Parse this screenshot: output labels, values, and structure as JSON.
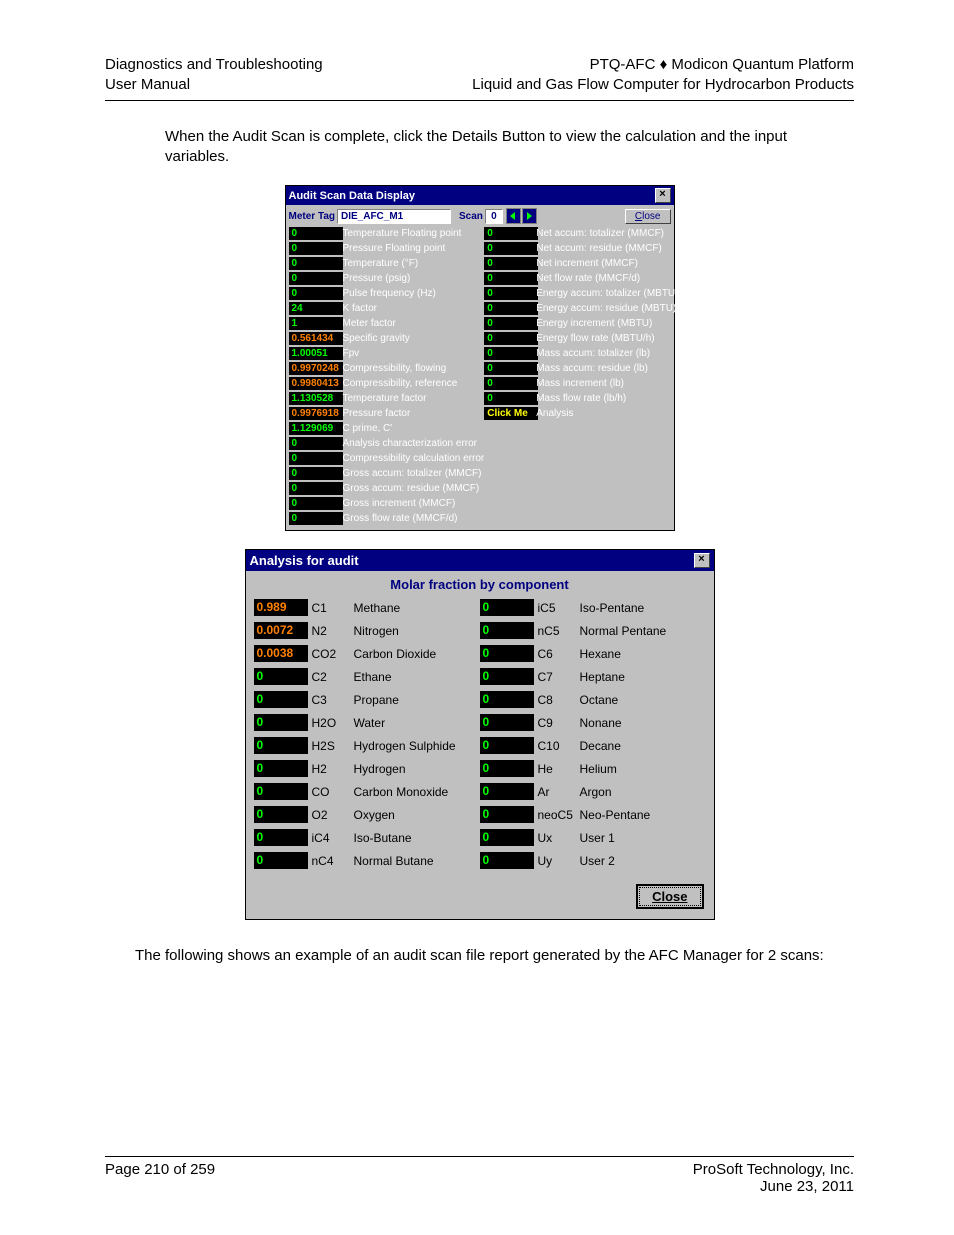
{
  "header": {
    "left1": "Diagnostics and Troubleshooting",
    "left2": "User Manual",
    "right1": "PTQ-AFC ♦ Modicon Quantum Platform",
    "right2": "Liquid and Gas Flow Computer for Hydrocarbon Products"
  },
  "paragraph1": "When the Audit Scan is complete, click the Details Button to view the calculation and the input variables.",
  "paragraph2": "The following shows an example of an audit scan file report generated by the AFC Manager for 2 scans:",
  "footer": {
    "page": "Page 210 of 259",
    "company": "ProSoft Technology, Inc.",
    "date": "June 23, 2011"
  },
  "audit": {
    "title": "Audit Scan Data Display",
    "meterTagLabel": "Meter Tag",
    "meterTagValue": "DIE_AFC_M1",
    "scanLabel": "Scan",
    "scanValue": "0",
    "closeLabel": "Close",
    "clickMe": "Click Me",
    "clickMeLabel": "Analysis",
    "left": [
      {
        "v": "0",
        "l": "Temperature Floating point"
      },
      {
        "v": "0",
        "l": "Pressure Floating point"
      },
      {
        "v": "0",
        "l": "Temperature (°F)"
      },
      {
        "v": "0",
        "l": "Pressure (psig)"
      },
      {
        "v": "0",
        "l": "Pulse frequency (Hz)"
      },
      {
        "v": "24",
        "l": "K factor"
      },
      {
        "v": "1",
        "l": "Meter factor"
      },
      {
        "v": "0.561434",
        "c": "orange",
        "l": "Specific gravity"
      },
      {
        "v": "1.00051",
        "l": "Fpv"
      },
      {
        "v": "0.9970248",
        "c": "orange",
        "l": "Compressibility, flowing"
      },
      {
        "v": "0.9980413",
        "c": "orange",
        "l": "Compressibility, reference"
      },
      {
        "v": "1.130528",
        "l": "Temperature factor"
      },
      {
        "v": "0.9976918",
        "c": "orange",
        "l": "Pressure factor"
      },
      {
        "v": "1.129069",
        "l": "C prime, C'"
      },
      {
        "v": "0",
        "l": "Analysis characterization error"
      },
      {
        "v": "0",
        "l": "Compressibility calculation error"
      },
      {
        "v": "0",
        "l": "Gross accum: totalizer (MMCF)"
      },
      {
        "v": "0",
        "l": "Gross accum: residue (MMCF)"
      },
      {
        "v": "0",
        "l": "Gross increment (MMCF)"
      },
      {
        "v": "0",
        "l": "Gross flow rate (MMCF/d)"
      }
    ],
    "right": [
      {
        "v": "0",
        "l": "Net accum: totalizer (MMCF)"
      },
      {
        "v": "0",
        "l": "Net accum: residue (MMCF)"
      },
      {
        "v": "0",
        "l": "Net increment (MMCF)"
      },
      {
        "v": "0",
        "l": "Net flow rate (MMCF/d)"
      },
      {
        "v": "0",
        "l": "Energy accum: totalizer (MBTU)"
      },
      {
        "v": "0",
        "l": "Energy accum: residue (MBTU)"
      },
      {
        "v": "0",
        "l": "Energy increment (MBTU)"
      },
      {
        "v": "0",
        "l": "Energy flow rate (MBTU/h)"
      },
      {
        "v": "0",
        "l": "Mass accum: totalizer (lb)"
      },
      {
        "v": "0",
        "l": "Mass accum: residue (lb)"
      },
      {
        "v": "0",
        "l": "Mass increment (lb)"
      },
      {
        "v": "0",
        "l": "Mass flow rate (lb/h)"
      }
    ]
  },
  "analysis": {
    "title": "Analysis for audit",
    "subtitle": "Molar fraction by component",
    "closeLabel": "lose",
    "closePrefix": "C",
    "left": [
      {
        "v": "0.989",
        "c": "orange",
        "s": "C1",
        "n": "Methane"
      },
      {
        "v": "0.0072",
        "c": "orange",
        "s": "N2",
        "n": "Nitrogen"
      },
      {
        "v": "0.0038",
        "c": "orange",
        "s": "CO2",
        "n": "Carbon Dioxide"
      },
      {
        "v": "0",
        "s": "C2",
        "n": "Ethane"
      },
      {
        "v": "0",
        "s": "C3",
        "n": "Propane"
      },
      {
        "v": "0",
        "s": "H2O",
        "n": "Water"
      },
      {
        "v": "0",
        "s": "H2S",
        "n": "Hydrogen Sulphide"
      },
      {
        "v": "0",
        "s": "H2",
        "n": "Hydrogen"
      },
      {
        "v": "0",
        "s": "CO",
        "n": "Carbon Monoxide"
      },
      {
        "v": "0",
        "s": "O2",
        "n": "Oxygen"
      },
      {
        "v": "0",
        "s": "iC4",
        "n": "Iso-Butane"
      },
      {
        "v": "0",
        "s": "nC4",
        "n": "Normal Butane"
      }
    ],
    "right": [
      {
        "v": "0",
        "s": "iC5",
        "n": "Iso-Pentane"
      },
      {
        "v": "0",
        "s": "nC5",
        "n": "Normal Pentane"
      },
      {
        "v": "0",
        "s": "C6",
        "n": "Hexane"
      },
      {
        "v": "0",
        "s": "C7",
        "n": "Heptane"
      },
      {
        "v": "0",
        "s": "C8",
        "n": "Octane"
      },
      {
        "v": "0",
        "s": "C9",
        "n": "Nonane"
      },
      {
        "v": "0",
        "s": "C10",
        "n": "Decane"
      },
      {
        "v": "0",
        "s": "He",
        "n": "Helium"
      },
      {
        "v": "0",
        "s": "Ar",
        "n": "Argon"
      },
      {
        "v": "0",
        "s": "neoC5",
        "n": "Neo-Pentane"
      },
      {
        "v": "0",
        "s": "Ux",
        "n": "User 1"
      },
      {
        "v": "0",
        "s": "Uy",
        "n": "User 2"
      }
    ]
  }
}
